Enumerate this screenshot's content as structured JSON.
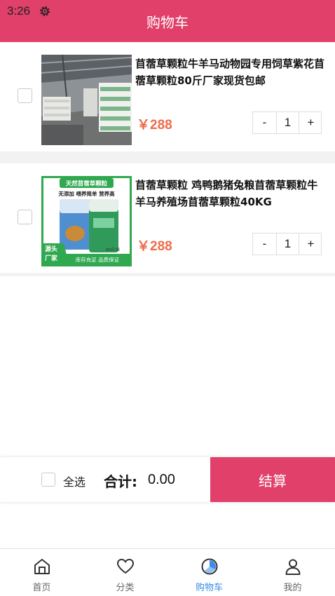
{
  "status_bar": {
    "time": "3:26",
    "icon": "gear-icon"
  },
  "header": {
    "title": "购物车"
  },
  "colors": {
    "accent": "#e0406a",
    "price": "#ef6b4a",
    "active_tab": "#3a8ee6"
  },
  "cart": {
    "items": [
      {
        "title": "苜蓿草颗粒牛羊马动物园专用饲草紫花苜蓿草颗粒80斤厂家现货包邮",
        "price": "￥288",
        "quantity": "1",
        "minus": "-",
        "plus": "+",
        "image": "warehouse-photo"
      },
      {
        "title": "苜蓿草颗粒 鸡鸭鹅猪兔粮苜蓿草颗粒牛羊马养殖场苜蓿草颗粒40KG",
        "price": "￥288",
        "quantity": "1",
        "minus": "-",
        "plus": "+",
        "image": "product-bag-photo",
        "image_text": {
          "banner": "天然苜蓿草颗粒",
          "features": "无添加 喂养简单 营养高",
          "badge_line1": "源头",
          "badge_line2": "厂家",
          "footer": "库存充足  品质保证",
          "weight": "80斤/袋"
        }
      }
    ]
  },
  "checkout": {
    "select_all_label": "全选",
    "total_label": "合计:",
    "total_value": "0.00",
    "button_label": "结算"
  },
  "tabbar": {
    "tabs": [
      {
        "label": "首页",
        "icon": "home-icon",
        "active": false
      },
      {
        "label": "分类",
        "icon": "heart-icon",
        "active": false
      },
      {
        "label": "购物车",
        "icon": "cart-icon",
        "active": true
      },
      {
        "label": "我的",
        "icon": "user-icon",
        "active": false
      }
    ]
  }
}
